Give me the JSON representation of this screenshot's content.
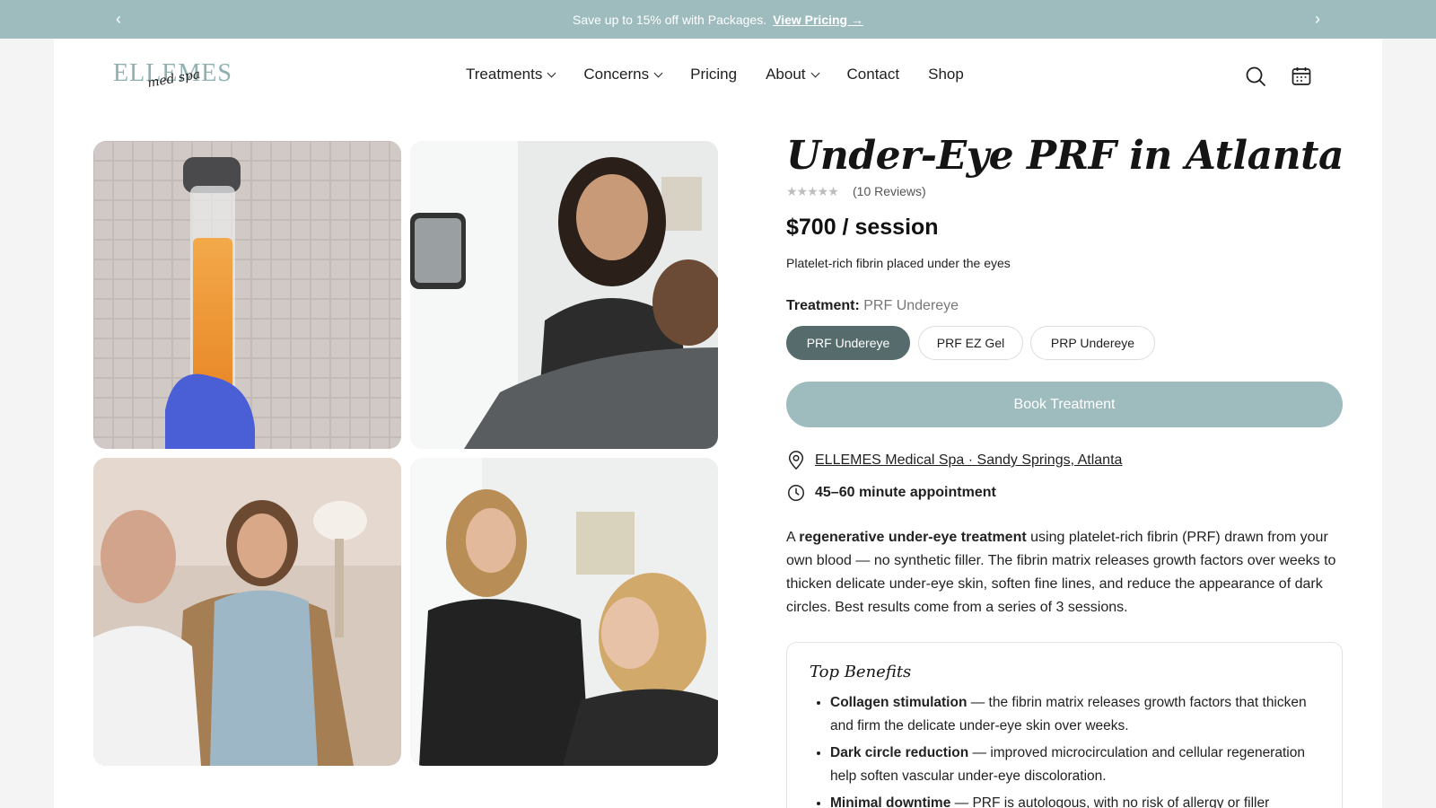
{
  "announcement": {
    "text": "Save up to 15% off with Packages.",
    "link": "View Pricing →",
    "prev_icon": "chevron-left-icon",
    "next_icon": "chevron-right-icon"
  },
  "brand": {
    "logo_word": "ELLEMES",
    "logo_script": "med spa"
  },
  "nav": {
    "items": [
      {
        "label": "Treatments",
        "has_dropdown": true
      },
      {
        "label": "Concerns",
        "has_dropdown": true
      },
      {
        "label": "Pricing",
        "has_dropdown": false
      },
      {
        "label": "About",
        "has_dropdown": true
      },
      {
        "label": "Contact",
        "has_dropdown": false
      },
      {
        "label": "Shop",
        "has_dropdown": false
      }
    ],
    "icons": [
      "search-icon",
      "calendar-icon"
    ]
  },
  "gallery": {
    "images": [
      "prf-tube-photo",
      "mirror-consult-photo",
      "consultation-chat-photo",
      "face-exam-photo"
    ]
  },
  "product": {
    "title": "Under-Eye PRF in Atlanta",
    "stars": "★★★★★",
    "reviews": "(10 Reviews)",
    "price": "$700 / session",
    "subtitle": "Platelet-rich fibrin placed under the eyes",
    "treatment_label": "Treatment:",
    "treatment_value": "PRF Undereye",
    "options": [
      "PRF Undereye",
      "PRF EZ Gel",
      "PRP Undereye"
    ],
    "book_label": "Book Treatment",
    "location": "ELLEMES Medical Spa · Sandy Springs, Atlanta",
    "duration": "45–60 minute appointment",
    "desc_prefix": "A ",
    "desc_bold": "regenerative under-eye treatment",
    "desc_rest": " using platelet-rich fibrin (PRF) drawn from your own blood — no synthetic filler. The fibrin matrix releases growth factors over weeks to thicken delicate under-eye skin, soften fine lines, and reduce the appearance of dark circles. Best results come from a series of 3 sessions."
  },
  "benefits": {
    "heading": "Top Benefits",
    "items": [
      {
        "title": "Collagen stimulation",
        "text": " — the fibrin matrix releases growth factors that thicken and firm the delicate under-eye skin over weeks."
      },
      {
        "title": "Dark circle reduction",
        "text": " — improved microcirculation and cellular regeneration help soften vascular under-eye discoloration."
      },
      {
        "title": "Minimal downtime",
        "text": " — PRF is autologous, with no risk of allergy or filler"
      }
    ]
  },
  "colors": {
    "accent": "#9ebbbd",
    "active_pill": "#566c6c"
  }
}
